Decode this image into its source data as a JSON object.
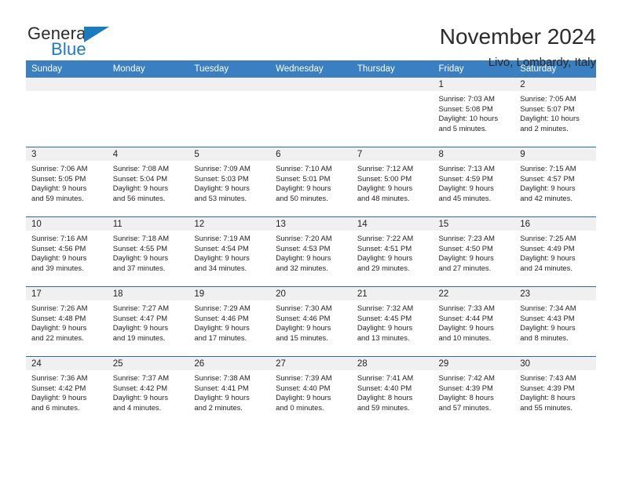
{
  "brand": {
    "word_one": "General",
    "word_two": "Blue",
    "triangle_icon": "blue-triangle-icon",
    "accent_color": "#1b7bc1"
  },
  "header": {
    "month_title": "November 2024",
    "location": "Livo, Lombardy, Italy"
  },
  "calendar": {
    "header_color": "#3a7fc1",
    "row_border_color": "#2e6da4",
    "daynum_bg": "#f0f0f0",
    "weekdays": [
      "Sunday",
      "Monday",
      "Tuesday",
      "Wednesday",
      "Thursday",
      "Friday",
      "Saturday"
    ],
    "weeks": [
      [
        {
          "day": "",
          "lines": []
        },
        {
          "day": "",
          "lines": []
        },
        {
          "day": "",
          "lines": []
        },
        {
          "day": "",
          "lines": []
        },
        {
          "day": "",
          "lines": []
        },
        {
          "day": "1",
          "lines": [
            "Sunrise: 7:03 AM",
            "Sunset: 5:08 PM",
            "Daylight: 10 hours",
            "and 5 minutes."
          ]
        },
        {
          "day": "2",
          "lines": [
            "Sunrise: 7:05 AM",
            "Sunset: 5:07 PM",
            "Daylight: 10 hours",
            "and 2 minutes."
          ]
        }
      ],
      [
        {
          "day": "3",
          "lines": [
            "Sunrise: 7:06 AM",
            "Sunset: 5:05 PM",
            "Daylight: 9 hours",
            "and 59 minutes."
          ]
        },
        {
          "day": "4",
          "lines": [
            "Sunrise: 7:08 AM",
            "Sunset: 5:04 PM",
            "Daylight: 9 hours",
            "and 56 minutes."
          ]
        },
        {
          "day": "5",
          "lines": [
            "Sunrise: 7:09 AM",
            "Sunset: 5:03 PM",
            "Daylight: 9 hours",
            "and 53 minutes."
          ]
        },
        {
          "day": "6",
          "lines": [
            "Sunrise: 7:10 AM",
            "Sunset: 5:01 PM",
            "Daylight: 9 hours",
            "and 50 minutes."
          ]
        },
        {
          "day": "7",
          "lines": [
            "Sunrise: 7:12 AM",
            "Sunset: 5:00 PM",
            "Daylight: 9 hours",
            "and 48 minutes."
          ]
        },
        {
          "day": "8",
          "lines": [
            "Sunrise: 7:13 AM",
            "Sunset: 4:59 PM",
            "Daylight: 9 hours",
            "and 45 minutes."
          ]
        },
        {
          "day": "9",
          "lines": [
            "Sunrise: 7:15 AM",
            "Sunset: 4:57 PM",
            "Daylight: 9 hours",
            "and 42 minutes."
          ]
        }
      ],
      [
        {
          "day": "10",
          "lines": [
            "Sunrise: 7:16 AM",
            "Sunset: 4:56 PM",
            "Daylight: 9 hours",
            "and 39 minutes."
          ]
        },
        {
          "day": "11",
          "lines": [
            "Sunrise: 7:18 AM",
            "Sunset: 4:55 PM",
            "Daylight: 9 hours",
            "and 37 minutes."
          ]
        },
        {
          "day": "12",
          "lines": [
            "Sunrise: 7:19 AM",
            "Sunset: 4:54 PM",
            "Daylight: 9 hours",
            "and 34 minutes."
          ]
        },
        {
          "day": "13",
          "lines": [
            "Sunrise: 7:20 AM",
            "Sunset: 4:53 PM",
            "Daylight: 9 hours",
            "and 32 minutes."
          ]
        },
        {
          "day": "14",
          "lines": [
            "Sunrise: 7:22 AM",
            "Sunset: 4:51 PM",
            "Daylight: 9 hours",
            "and 29 minutes."
          ]
        },
        {
          "day": "15",
          "lines": [
            "Sunrise: 7:23 AM",
            "Sunset: 4:50 PM",
            "Daylight: 9 hours",
            "and 27 minutes."
          ]
        },
        {
          "day": "16",
          "lines": [
            "Sunrise: 7:25 AM",
            "Sunset: 4:49 PM",
            "Daylight: 9 hours",
            "and 24 minutes."
          ]
        }
      ],
      [
        {
          "day": "17",
          "lines": [
            "Sunrise: 7:26 AM",
            "Sunset: 4:48 PM",
            "Daylight: 9 hours",
            "and 22 minutes."
          ]
        },
        {
          "day": "18",
          "lines": [
            "Sunrise: 7:27 AM",
            "Sunset: 4:47 PM",
            "Daylight: 9 hours",
            "and 19 minutes."
          ]
        },
        {
          "day": "19",
          "lines": [
            "Sunrise: 7:29 AM",
            "Sunset: 4:46 PM",
            "Daylight: 9 hours",
            "and 17 minutes."
          ]
        },
        {
          "day": "20",
          "lines": [
            "Sunrise: 7:30 AM",
            "Sunset: 4:46 PM",
            "Daylight: 9 hours",
            "and 15 minutes."
          ]
        },
        {
          "day": "21",
          "lines": [
            "Sunrise: 7:32 AM",
            "Sunset: 4:45 PM",
            "Daylight: 9 hours",
            "and 13 minutes."
          ]
        },
        {
          "day": "22",
          "lines": [
            "Sunrise: 7:33 AM",
            "Sunset: 4:44 PM",
            "Daylight: 9 hours",
            "and 10 minutes."
          ]
        },
        {
          "day": "23",
          "lines": [
            "Sunrise: 7:34 AM",
            "Sunset: 4:43 PM",
            "Daylight: 9 hours",
            "and 8 minutes."
          ]
        }
      ],
      [
        {
          "day": "24",
          "lines": [
            "Sunrise: 7:36 AM",
            "Sunset: 4:42 PM",
            "Daylight: 9 hours",
            "and 6 minutes."
          ]
        },
        {
          "day": "25",
          "lines": [
            "Sunrise: 7:37 AM",
            "Sunset: 4:42 PM",
            "Daylight: 9 hours",
            "and 4 minutes."
          ]
        },
        {
          "day": "26",
          "lines": [
            "Sunrise: 7:38 AM",
            "Sunset: 4:41 PM",
            "Daylight: 9 hours",
            "and 2 minutes."
          ]
        },
        {
          "day": "27",
          "lines": [
            "Sunrise: 7:39 AM",
            "Sunset: 4:40 PM",
            "Daylight: 9 hours",
            "and 0 minutes."
          ]
        },
        {
          "day": "28",
          "lines": [
            "Sunrise: 7:41 AM",
            "Sunset: 4:40 PM",
            "Daylight: 8 hours",
            "and 59 minutes."
          ]
        },
        {
          "day": "29",
          "lines": [
            "Sunrise: 7:42 AM",
            "Sunset: 4:39 PM",
            "Daylight: 8 hours",
            "and 57 minutes."
          ]
        },
        {
          "day": "30",
          "lines": [
            "Sunrise: 7:43 AM",
            "Sunset: 4:39 PM",
            "Daylight: 8 hours",
            "and 55 minutes."
          ]
        }
      ]
    ]
  }
}
